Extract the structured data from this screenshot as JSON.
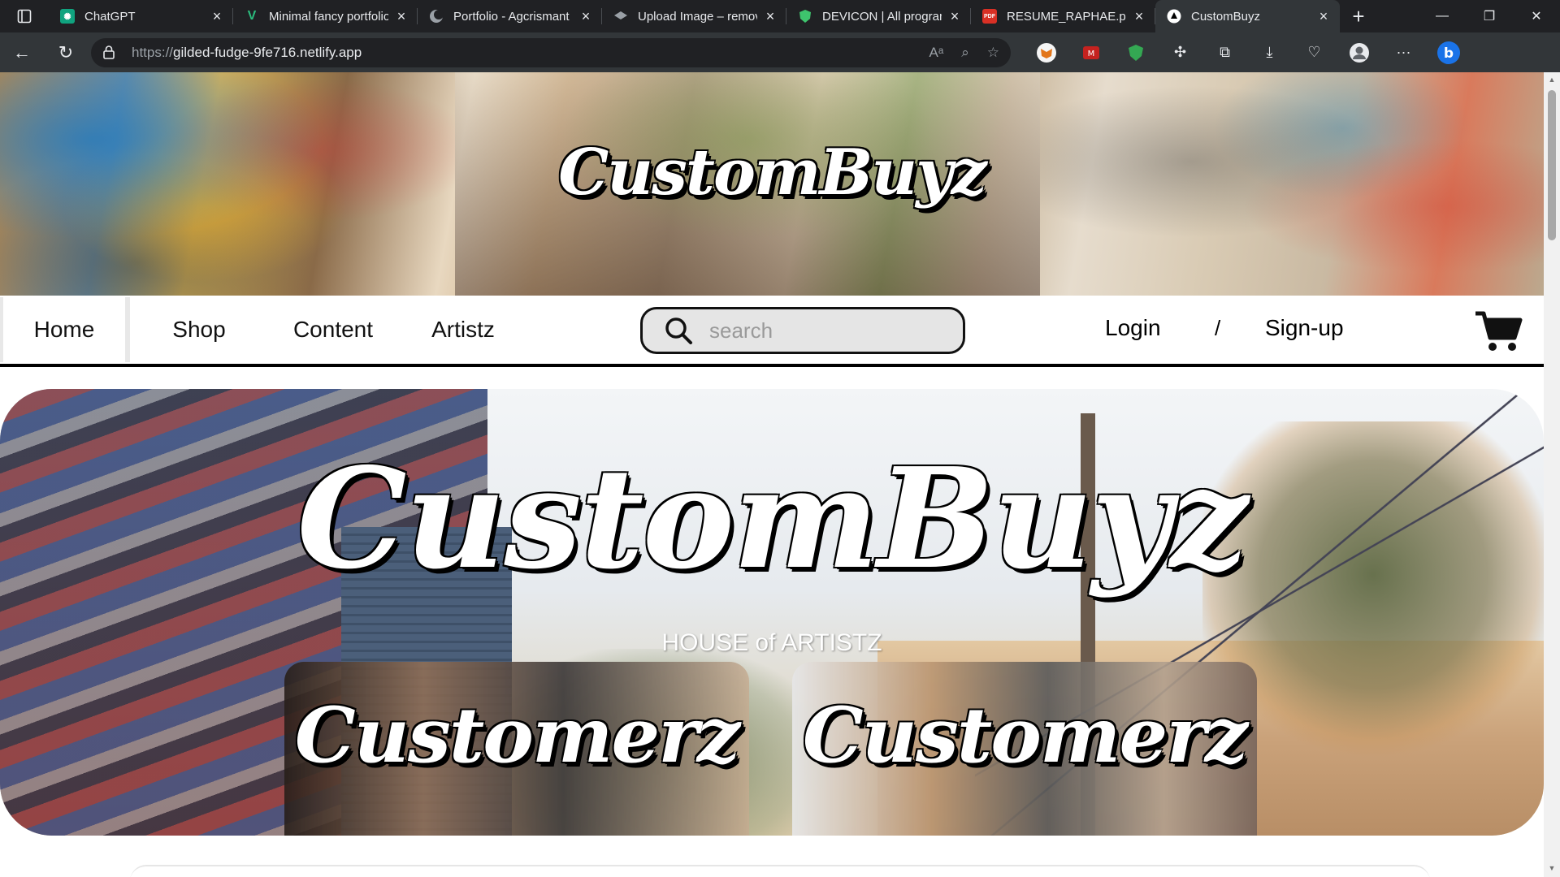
{
  "browser": {
    "tabs": [
      {
        "title": "ChatGPT",
        "icon": "chatgpt-icon",
        "color": "#10a37f",
        "active": false
      },
      {
        "title": "Minimal fancy portfolio",
        "icon": "v-logo-icon",
        "color": "#2bbd7e",
        "active": false
      },
      {
        "title": "Portfolio - Agcrismant",
        "icon": "moon-icon",
        "color": "#9aa0a6",
        "active": false
      },
      {
        "title": "Upload Image – remove",
        "icon": "layers-icon",
        "color": "#9aa0a6",
        "active": false
      },
      {
        "title": "DEVICON | All programming",
        "icon": "shield-icon",
        "color": "#3ec46d",
        "active": false
      },
      {
        "title": "RESUME_RAPHAE.pdf",
        "icon": "pdf-icon",
        "color": "#d93025",
        "active": false
      },
      {
        "title": "CustomBuyz",
        "icon": "netlify-icon",
        "color": "#ffffff",
        "active": true
      }
    ],
    "url_prefix": "https://",
    "url_host": "gilded-fudge-9fe716.netlify.app"
  },
  "site": {
    "banner_logo": "CustomBuyz",
    "nav": {
      "home": "Home",
      "shop": "Shop",
      "content": "Content",
      "artistz": "Artistz",
      "search_placeholder": "search",
      "login": "Login",
      "separator": "/",
      "signup": "Sign-up"
    },
    "hero": {
      "logo": "CustomBuyz",
      "tagline": "HOUSE of ARTISTZ",
      "cards": [
        {
          "title": "Customerz"
        },
        {
          "title": "Customerz"
        }
      ]
    }
  },
  "colors": {
    "chrome_dark": "#202124",
    "chrome_toolbar": "#323639",
    "nav_underline": "#000000",
    "search_bg": "#e5e5e5"
  }
}
